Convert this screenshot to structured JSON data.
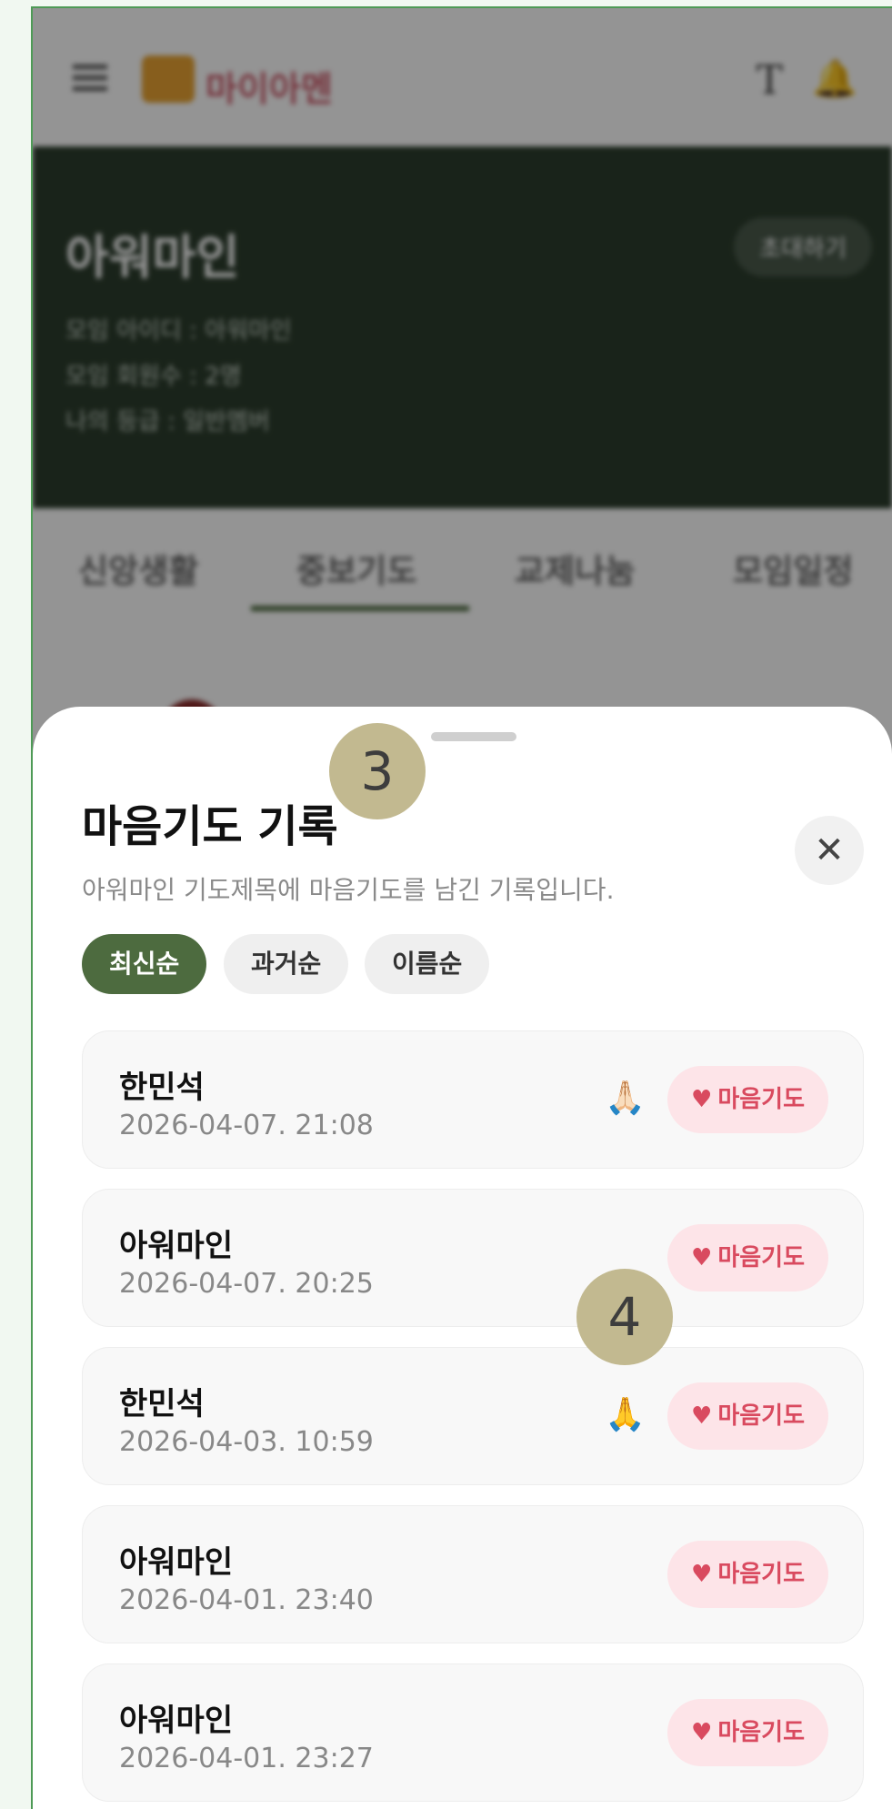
{
  "header": {
    "logo_text": "마이아멘",
    "font_icon_glyph": "T",
    "bell_icon": "bell-icon"
  },
  "group": {
    "name": "아워마인",
    "invite_label": "초대하기",
    "meta": [
      "모임 아이디 : 아워마인",
      "모임 회원수 : 2명",
      "나의 등급 : 일반멤버"
    ]
  },
  "tabs": [
    "신앙생활",
    "중보기도",
    "교제나눔",
    "모임일정"
  ],
  "sheet": {
    "title": "마음기도 기록",
    "subtitle": "아워마인 기도제목에 마음기도를 남긴 기록입니다.",
    "close_glyph": "✕",
    "sort": [
      "최신순",
      "과거순",
      "이름순"
    ],
    "button_label": "마음기도",
    "heart_glyph": "♥",
    "records": [
      {
        "name": "한민석",
        "date": "2026-04-07. 21:08",
        "emoji": "🙏🏻"
      },
      {
        "name": "아워마인",
        "date": "2026-04-07. 20:25",
        "emoji": ""
      },
      {
        "name": "한민석",
        "date": "2026-04-03. 10:59",
        "emoji": "🙏"
      },
      {
        "name": "아워마인",
        "date": "2026-04-01. 23:40",
        "emoji": ""
      },
      {
        "name": "아워마인",
        "date": "2026-04-01. 23:27",
        "emoji": ""
      }
    ]
  },
  "markers": [
    "3",
    "4"
  ],
  "colors": {
    "accent": "#4d6b3f",
    "pray_bg": "#fde4e8",
    "pray_text": "#d94a5f",
    "marker": "#c2b990"
  }
}
